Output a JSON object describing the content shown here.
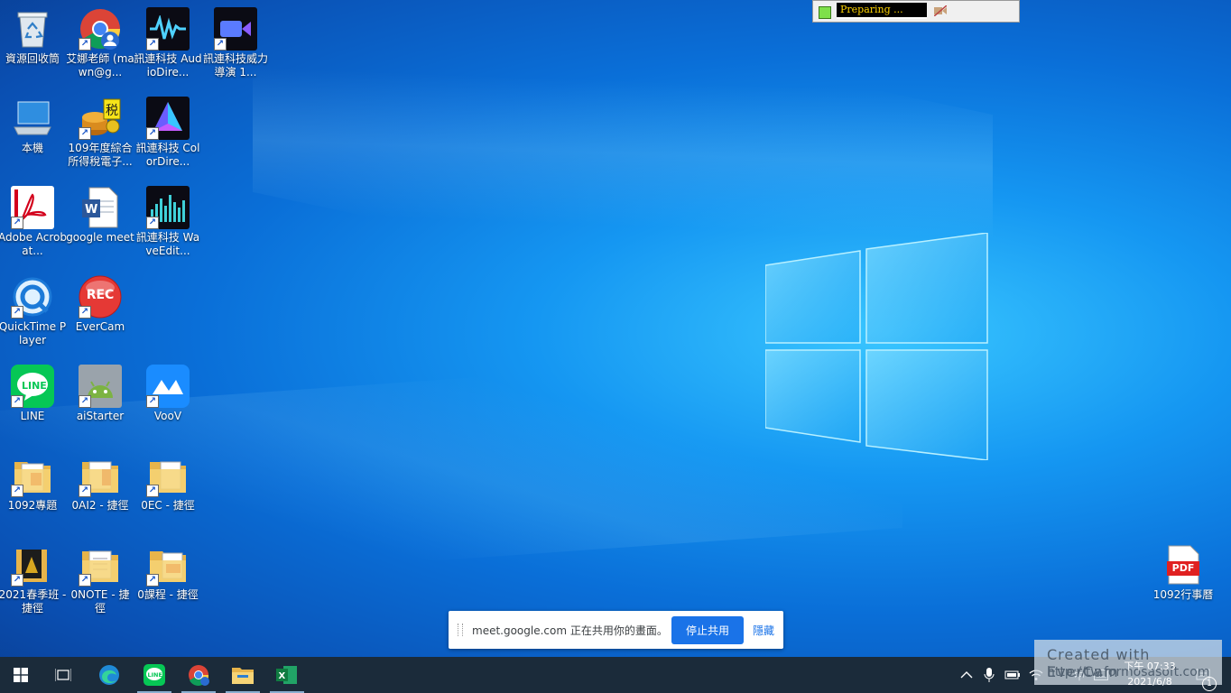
{
  "desktop": {
    "icons": [
      {
        "label": "資源回收筒"
      },
      {
        "label": "艾娜老師 (mawn@g..."
      },
      {
        "label": "訊連科技 AudioDire..."
      },
      {
        "label": "訊連科技威力導演 1..."
      },
      {
        "label": "本機"
      },
      {
        "label": "109年度綜合所得稅電子..."
      },
      {
        "label": "訊連科技 ColorDire..."
      },
      {
        "label": "Adobe Acrobat..."
      },
      {
        "label": "google meet"
      },
      {
        "label": "訊連科技 WaveEdit..."
      },
      {
        "label": "QuickTime Player"
      },
      {
        "label": "EverCam"
      },
      {
        "label": "LINE"
      },
      {
        "label": "aiStarter"
      },
      {
        "label": "VooV"
      },
      {
        "label": "1092專題"
      },
      {
        "label": "0AI2 - 捷徑"
      },
      {
        "label": "0EC - 捷徑"
      },
      {
        "label": "2021春季班 - 捷徑"
      },
      {
        "label": "0NOTE - 捷徑"
      },
      {
        "label": "0課程 - 捷徑"
      },
      {
        "label": "1092行事曆"
      }
    ],
    "rec_text": "REC",
    "pdf_text": "PDF"
  },
  "recorder_bar": {
    "status": "Preparing ..."
  },
  "share_banner": {
    "message": "meet.google.com 正在共用你的畫面。",
    "stop_label": "停止共用",
    "hide_label": "隱藏"
  },
  "watermark": {
    "line1": "Created  with  EverCam",
    "line2": "http://tw.formosasoft.com"
  },
  "clock": {
    "time": "下午 07:33",
    "date": "2021/6/8"
  },
  "tray": {
    "lang": "中",
    "notif_count": "1"
  },
  "colors": {
    "accent": "#1a73e8",
    "taskbar": "#1b2b3a"
  }
}
